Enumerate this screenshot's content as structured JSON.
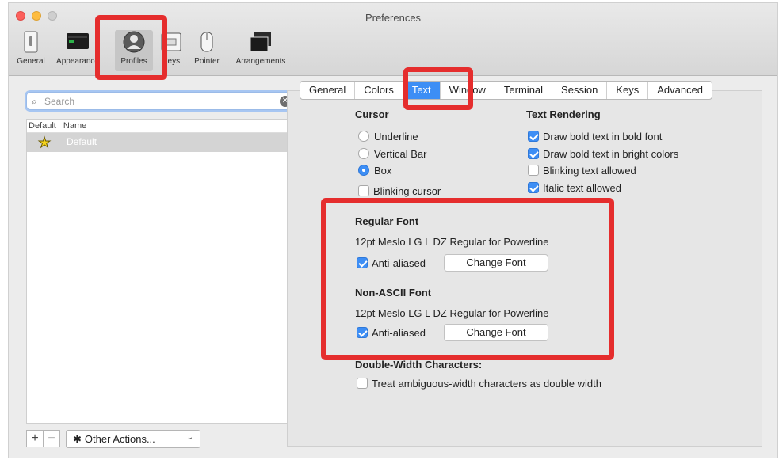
{
  "window": {
    "title": "Preferences"
  },
  "toolbar": {
    "items": [
      {
        "label": "General",
        "icon": "switch-icon"
      },
      {
        "label": "Appearance",
        "icon": "display-icon"
      },
      {
        "label": "Profiles",
        "icon": "profile-icon",
        "selected": true
      },
      {
        "label": "Keys",
        "icon": "keyboard-icon"
      },
      {
        "label": "Pointer",
        "icon": "mouse-icon"
      },
      {
        "label": "Arrangements",
        "icon": "windows-icon"
      }
    ]
  },
  "sidebar": {
    "search_placeholder": "Search",
    "list_headers": {
      "default": "Default",
      "name": "Name"
    },
    "profiles": [
      {
        "name": "Default",
        "is_default": true
      }
    ],
    "add_label": "+",
    "remove_label": "−",
    "other_actions_label": "Other Actions...",
    "chevron": "⌄"
  },
  "tabs": [
    "General",
    "Colors",
    "Text",
    "Window",
    "Terminal",
    "Session",
    "Keys",
    "Advanced"
  ],
  "active_tab": "Text",
  "cursor": {
    "heading": "Cursor",
    "options": [
      "Underline",
      "Vertical Bar",
      "Box"
    ],
    "selected": "Box",
    "blinking_label": "Blinking cursor",
    "blinking": false
  },
  "text_rendering": {
    "heading": "Text Rendering",
    "options": [
      {
        "label": "Draw bold text in bold font",
        "checked": true
      },
      {
        "label": "Draw bold text in bright colors",
        "checked": true
      },
      {
        "label": "Blinking text allowed",
        "checked": false
      },
      {
        "label": "Italic text allowed",
        "checked": true
      }
    ]
  },
  "regular_font": {
    "heading": "Regular Font",
    "description": "12pt Meslo LG L DZ Regular for Powerline",
    "anti_aliased_label": "Anti-aliased",
    "anti_aliased": true,
    "button": "Change Font"
  },
  "non_ascii_font": {
    "heading": "Non-ASCII Font",
    "description": "12pt Meslo LG L DZ Regular for Powerline",
    "anti_aliased_label": "Anti-aliased",
    "anti_aliased": true,
    "button": "Change Font"
  },
  "double_width": {
    "heading": "Double-Width Characters:",
    "option_label": "Treat ambiguous-width characters as double width",
    "checked": false
  },
  "colors": {
    "accent": "#3d8ef5",
    "annotation": "#e52d2d"
  }
}
